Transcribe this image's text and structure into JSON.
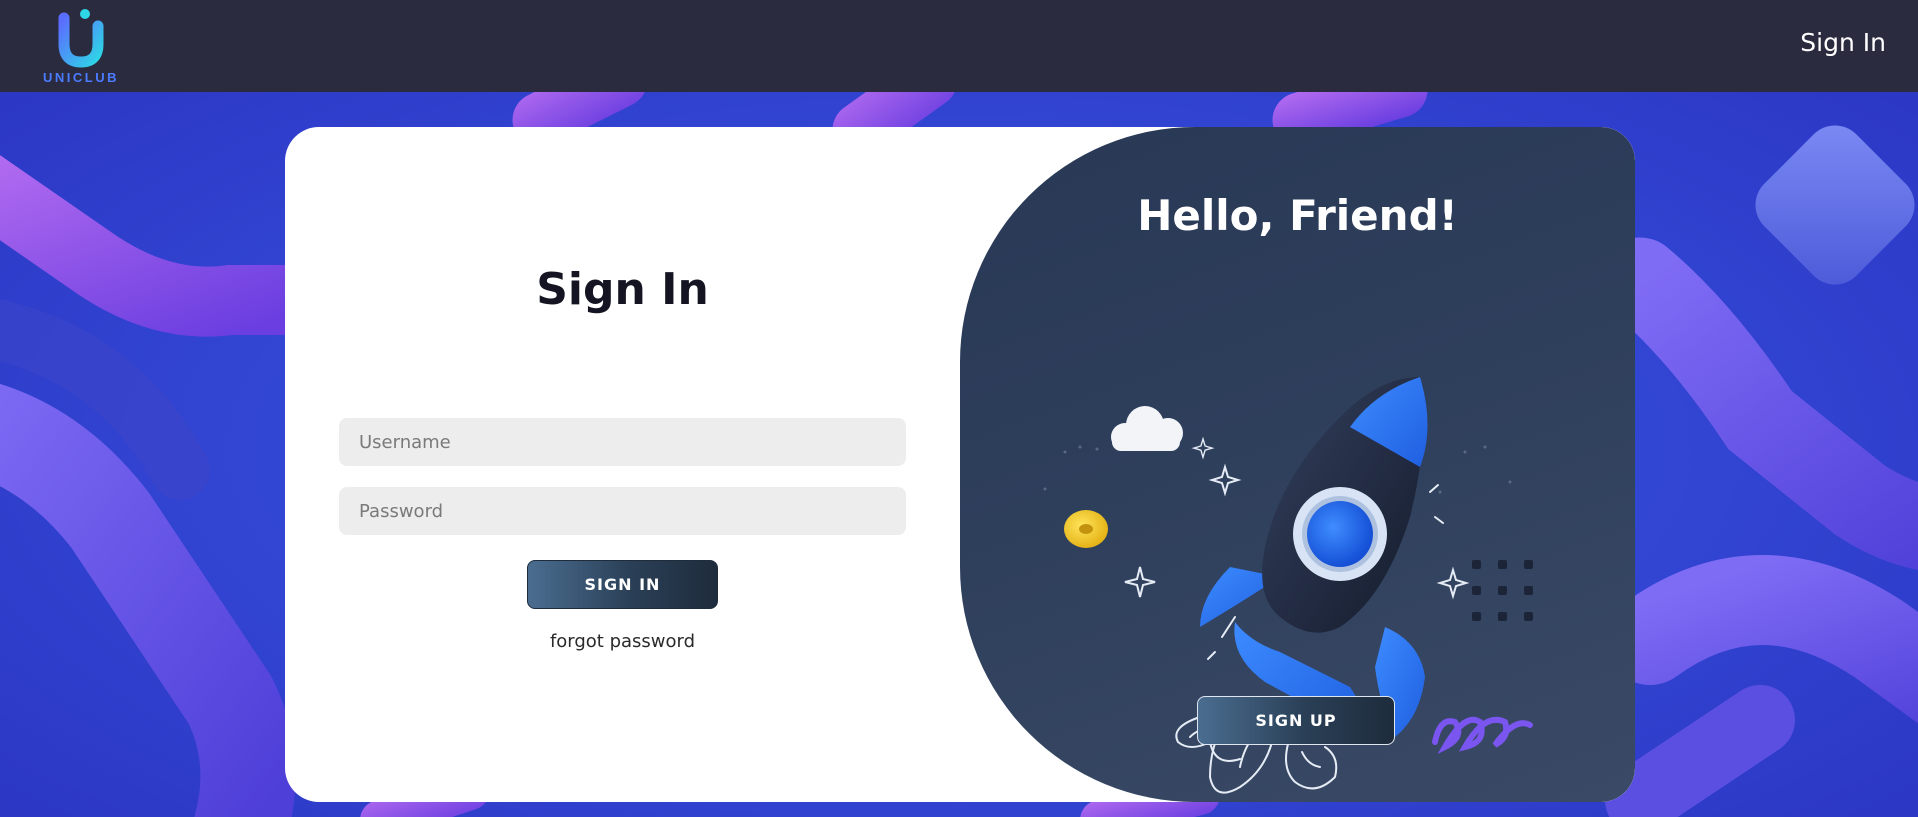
{
  "navbar": {
    "brand": "UNICLUB",
    "signin_link": "Sign In"
  },
  "login_form": {
    "title": "Sign In",
    "username_placeholder": "Username",
    "password_placeholder": "Password",
    "submit_label": "SIGN IN",
    "forgot_label": "forgot password"
  },
  "welcome_panel": {
    "title": "Hello, Friend!",
    "illustration_icon": "rocket-icon",
    "signup_label": "SIGN UP"
  },
  "colors": {
    "navbar_bg": "#2b2b40",
    "brand_accent": "#4b7bff",
    "panel_bg": "#2e3f5c",
    "input_bg": "#ededed",
    "button_gradient_start": "#4a6d90",
    "button_gradient_end": "#1e2c3c"
  }
}
